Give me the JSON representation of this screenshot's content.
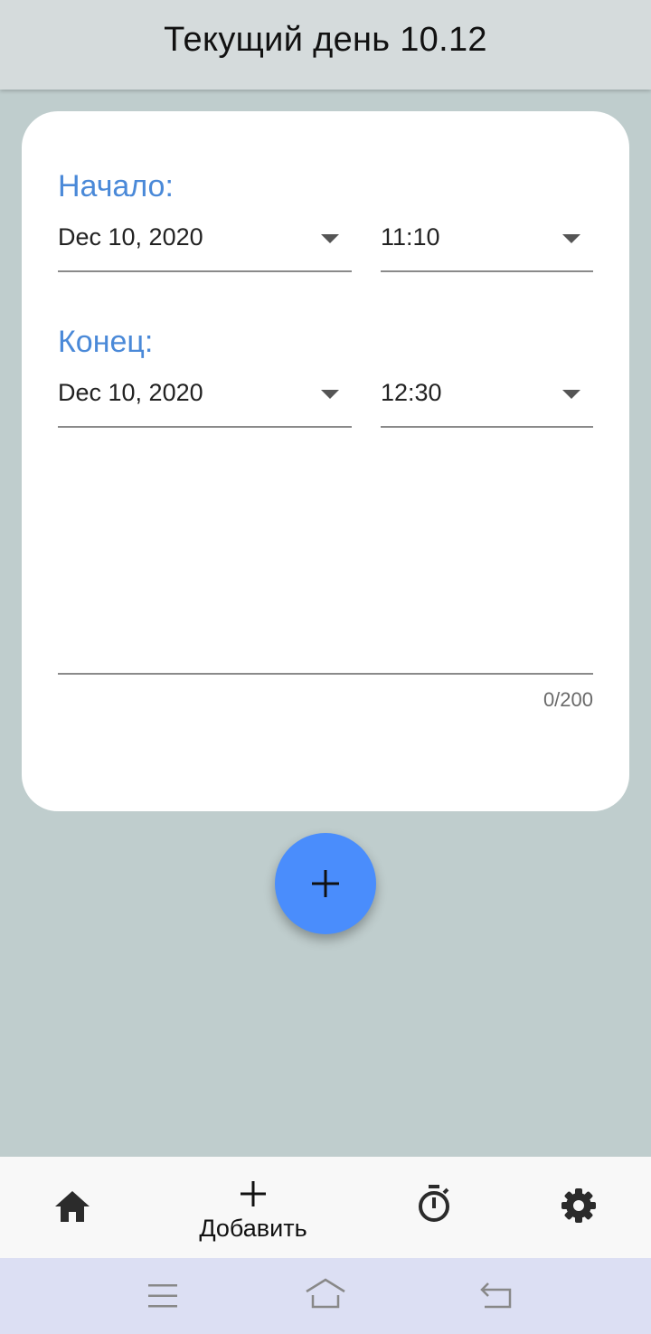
{
  "header": {
    "title": "Текущий день 10.12"
  },
  "start": {
    "label": "Начало:",
    "date": "Dec 10, 2020",
    "time": "11:10"
  },
  "end": {
    "label": "Конец:",
    "date": "Dec 10, 2020",
    "time": "12:30"
  },
  "notes": {
    "value": "",
    "counter": "0/200"
  },
  "fab": {
    "icon": "plus-icon"
  },
  "bottom_nav": {
    "items": [
      {
        "icon": "home-icon",
        "label": ""
      },
      {
        "icon": "plus-icon",
        "label": "Добавить"
      },
      {
        "icon": "timer-icon",
        "label": ""
      },
      {
        "icon": "gear-icon",
        "label": ""
      }
    ]
  },
  "system_nav": {
    "icons": [
      "menu-icon",
      "home-outline-icon",
      "back-icon"
    ]
  },
  "colors": {
    "accent": "#4a89d8",
    "fab": "#4a8dfc",
    "background": "#bfcdcd",
    "appbar": "#d5dbdc"
  }
}
